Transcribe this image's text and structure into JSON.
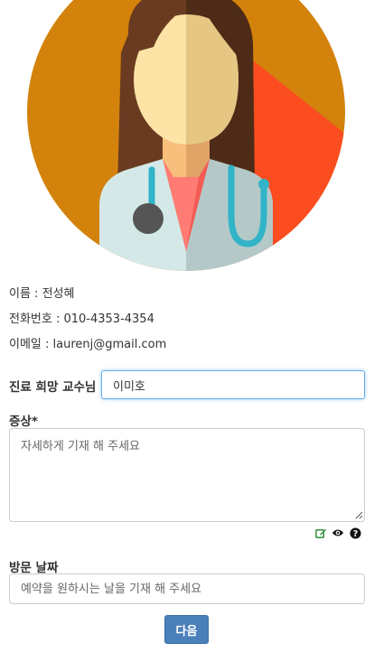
{
  "profile": {
    "name_line": "이름 : 전성혜",
    "phone_line": "전화번호 : 010-4353-4354",
    "email_line": "이메일 : laurenj@gmail.com"
  },
  "form": {
    "professor_label": "진료 희망 교수님",
    "professor_value": "이미호",
    "symptom_label": "증상*",
    "symptom_placeholder": "자세하게 기재 해 주세요",
    "date_label": "방문 날짜",
    "date_placeholder": "예약을 원하시는 날을 기재 해 주세요",
    "next_label": "다음"
  },
  "toolbar_icons": [
    "edit-icon",
    "eye-icon",
    "help-icon"
  ],
  "colors": {
    "avatar_bg": "#d3820b",
    "accent_red": "#fb4d1f",
    "button": "#4a7fba",
    "focus_border": "#66afe9"
  }
}
